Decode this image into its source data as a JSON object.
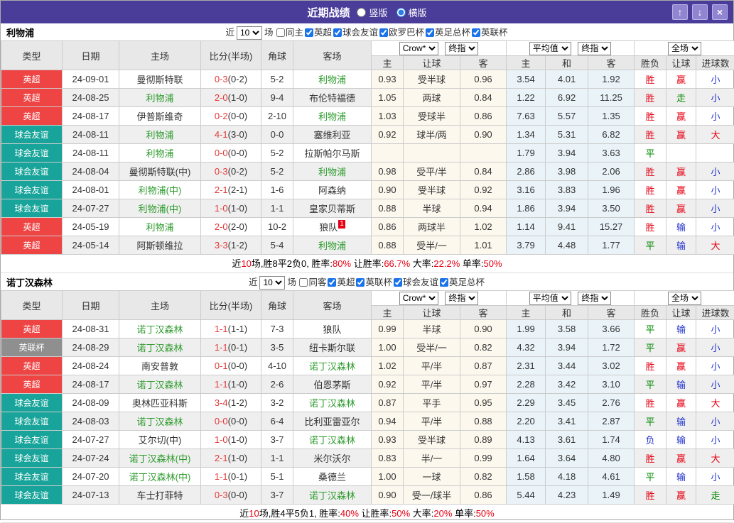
{
  "titlebar": {
    "title": "近期战绩",
    "radios": [
      {
        "label": "竖版",
        "checked": false
      },
      {
        "label": "横版",
        "checked": true
      }
    ],
    "buttons": {
      "up": "↑",
      "down": "↓",
      "close": "×"
    }
  },
  "table_header": {
    "main_cols": [
      "类型",
      "日期",
      "主场",
      "比分(半场)",
      "角球",
      "客场"
    ],
    "sub_cols": [
      "主",
      "让球",
      "客",
      "主",
      "和",
      "客",
      "胜负",
      "让球",
      "进球数"
    ],
    "selects": {
      "asia_company": "Crow*",
      "asia_index": "终指",
      "europe_avg": "平均值",
      "europe_index": "终指",
      "scope": "全场"
    }
  },
  "colors": {
    "titlebar_purple": "#4a3d99",
    "badge_red": "#ee4444",
    "badge_teal": "#18a49a",
    "badge_gray": "#8f8f8f",
    "win_red": "#e60012",
    "draw_green": "#008800",
    "lose_blue": "#2233cc",
    "team_green": "#2e9b2e",
    "asia_col_bg": "#fdf8ee",
    "europe_col_bg": "#e9f3f8"
  },
  "sections": [
    {
      "team": "利物浦",
      "filter": {
        "near": "近",
        "count": "10",
        "unit": "场",
        "same": {
          "label": "同主",
          "checked": false
        },
        "leagues": [
          {
            "label": "英超",
            "checked": true
          },
          {
            "label": "球会友谊",
            "checked": true
          },
          {
            "label": "欧罗巴杯",
            "checked": true
          },
          {
            "label": "英足总杯",
            "checked": true
          },
          {
            "label": "英联杯",
            "checked": true
          }
        ]
      },
      "rows": [
        {
          "league": "英超",
          "badge": "red",
          "date": "24-09-01",
          "home": {
            "name": "曼彻斯特联",
            "hl": false,
            "note": ""
          },
          "score": "0-3",
          "half": "(0-2)",
          "corner": "5-2",
          "away": {
            "name": "利物浦",
            "hl": true,
            "note": ""
          },
          "asia": [
            "0.93",
            "受半球",
            "0.96"
          ],
          "europe": [
            "3.54",
            "4.01",
            "1.92"
          ],
          "outcome": [
            [
              "胜",
              "r"
            ],
            [
              "赢",
              "r"
            ],
            [
              "小",
              "b"
            ]
          ]
        },
        {
          "league": "英超",
          "badge": "red",
          "date": "24-08-25",
          "home": {
            "name": "利物浦",
            "hl": true,
            "note": ""
          },
          "score": "2-0",
          "half": "(1-0)",
          "corner": "9-4",
          "away": {
            "name": "布伦特福德",
            "hl": false,
            "note": ""
          },
          "asia": [
            "1.05",
            "两球",
            "0.84"
          ],
          "europe": [
            "1.22",
            "6.92",
            "11.25"
          ],
          "outcome": [
            [
              "胜",
              "r"
            ],
            [
              "走",
              "g"
            ],
            [
              "小",
              "b"
            ]
          ]
        },
        {
          "league": "英超",
          "badge": "red",
          "date": "24-08-17",
          "home": {
            "name": "伊普斯维奇",
            "hl": false,
            "note": ""
          },
          "score": "0-2",
          "half": "(0-0)",
          "corner": "2-10",
          "away": {
            "name": "利物浦",
            "hl": true,
            "note": ""
          },
          "asia": [
            "1.03",
            "受球半",
            "0.86"
          ],
          "europe": [
            "7.63",
            "5.57",
            "1.35"
          ],
          "outcome": [
            [
              "胜",
              "r"
            ],
            [
              "赢",
              "r"
            ],
            [
              "小",
              "b"
            ]
          ]
        },
        {
          "league": "球会友谊",
          "badge": "teal",
          "date": "24-08-11",
          "home": {
            "name": "利物浦",
            "hl": true,
            "note": ""
          },
          "score": "4-1",
          "half": "(3-0)",
          "corner": "0-0",
          "away": {
            "name": "塞维利亚",
            "hl": false,
            "note": ""
          },
          "asia": [
            "0.92",
            "球半/两",
            "0.90"
          ],
          "europe": [
            "1.34",
            "5.31",
            "6.82"
          ],
          "outcome": [
            [
              "胜",
              "r"
            ],
            [
              "赢",
              "r"
            ],
            [
              "大",
              "r"
            ]
          ]
        },
        {
          "league": "球会友谊",
          "badge": "teal",
          "date": "24-08-11",
          "home": {
            "name": "利物浦",
            "hl": true,
            "note": ""
          },
          "score": "0-0",
          "half": "(0-0)",
          "corner": "5-2",
          "away": {
            "name": "拉斯帕尔马斯",
            "hl": false,
            "note": ""
          },
          "asia": [
            "",
            "",
            ""
          ],
          "europe": [
            "1.79",
            "3.94",
            "3.63"
          ],
          "outcome": [
            [
              "平",
              "g"
            ],
            [
              "",
              ""
            ],
            [
              "",
              ""
            ]
          ]
        },
        {
          "league": "球会友谊",
          "badge": "teal",
          "date": "24-08-04",
          "home": {
            "name": "曼彻斯特联(中)",
            "hl": false,
            "note": ""
          },
          "score": "0-3",
          "half": "(0-2)",
          "corner": "5-2",
          "away": {
            "name": "利物浦",
            "hl": true,
            "note": ""
          },
          "asia": [
            "0.98",
            "受平/半",
            "0.84"
          ],
          "europe": [
            "2.86",
            "3.98",
            "2.06"
          ],
          "outcome": [
            [
              "胜",
              "r"
            ],
            [
              "赢",
              "r"
            ],
            [
              "小",
              "b"
            ]
          ]
        },
        {
          "league": "球会友谊",
          "badge": "teal",
          "date": "24-08-01",
          "home": {
            "name": "利物浦(中)",
            "hl": true,
            "note": ""
          },
          "score": "2-1",
          "half": "(2-1)",
          "corner": "1-6",
          "away": {
            "name": "阿森纳",
            "hl": false,
            "note": ""
          },
          "asia": [
            "0.90",
            "受半球",
            "0.92"
          ],
          "europe": [
            "3.16",
            "3.83",
            "1.96"
          ],
          "outcome": [
            [
              "胜",
              "r"
            ],
            [
              "赢",
              "r"
            ],
            [
              "小",
              "b"
            ]
          ]
        },
        {
          "league": "球会友谊",
          "badge": "teal",
          "date": "24-07-27",
          "home": {
            "name": "利物浦(中)",
            "hl": true,
            "note": ""
          },
          "score": "1-0",
          "half": "(1-0)",
          "corner": "1-1",
          "away": {
            "name": "皇家贝蒂斯",
            "hl": false,
            "note": ""
          },
          "asia": [
            "0.88",
            "半球",
            "0.94"
          ],
          "europe": [
            "1.86",
            "3.94",
            "3.50"
          ],
          "outcome": [
            [
              "胜",
              "r"
            ],
            [
              "赢",
              "r"
            ],
            [
              "小",
              "b"
            ]
          ]
        },
        {
          "league": "英超",
          "badge": "red",
          "date": "24-05-19",
          "home": {
            "name": "利物浦",
            "hl": true,
            "note": ""
          },
          "score": "2-0",
          "half": "(2-0)",
          "corner": "10-2",
          "away": {
            "name": "狼队",
            "hl": false,
            "note": "1"
          },
          "asia": [
            "0.86",
            "两球半",
            "1.02"
          ],
          "europe": [
            "1.14",
            "9.41",
            "15.27"
          ],
          "outcome": [
            [
              "胜",
              "r"
            ],
            [
              "输",
              "b"
            ],
            [
              "小",
              "b"
            ]
          ]
        },
        {
          "league": "英超",
          "badge": "red",
          "date": "24-05-14",
          "home": {
            "name": "阿斯顿维拉",
            "hl": false,
            "note": ""
          },
          "score": "3-3",
          "half": "(1-2)",
          "corner": "5-4",
          "away": {
            "name": "利物浦",
            "hl": true,
            "note": ""
          },
          "asia": [
            "0.88",
            "受半/一",
            "1.01"
          ],
          "europe": [
            "3.79",
            "4.48",
            "1.77"
          ],
          "outcome": [
            [
              "平",
              "g"
            ],
            [
              "输",
              "b"
            ],
            [
              "大",
              "r"
            ]
          ]
        }
      ],
      "summary": [
        [
          "近",
          0
        ],
        [
          "10",
          1
        ],
        [
          "场,胜8平2负0, 胜率:",
          0
        ],
        [
          "80%",
          1
        ],
        [
          " 让胜率:",
          0
        ],
        [
          "66.7%",
          1
        ],
        [
          " 大率:",
          0
        ],
        [
          "22.2%",
          1
        ],
        [
          " 单率:",
          0
        ],
        [
          "50%",
          1
        ]
      ]
    },
    {
      "team": "诺丁汉森林",
      "filter": {
        "near": "近",
        "count": "10",
        "unit": "场",
        "same": {
          "label": "同客",
          "checked": false
        },
        "leagues": [
          {
            "label": "英超",
            "checked": true
          },
          {
            "label": "英联杯",
            "checked": true
          },
          {
            "label": "球会友谊",
            "checked": true
          },
          {
            "label": "英足总杯",
            "checked": true
          }
        ]
      },
      "rows": [
        {
          "league": "英超",
          "badge": "red",
          "date": "24-08-31",
          "home": {
            "name": "诺丁汉森林",
            "hl": true,
            "note": ""
          },
          "score": "1-1",
          "half": "(1-1)",
          "corner": "7-3",
          "away": {
            "name": "狼队",
            "hl": false,
            "note": ""
          },
          "asia": [
            "0.99",
            "半球",
            "0.90"
          ],
          "europe": [
            "1.99",
            "3.58",
            "3.66"
          ],
          "outcome": [
            [
              "平",
              "g"
            ],
            [
              "输",
              "b"
            ],
            [
              "小",
              "b"
            ]
          ]
        },
        {
          "league": "英联杯",
          "badge": "gray",
          "date": "24-08-29",
          "home": {
            "name": "诺丁汉森林",
            "hl": true,
            "note": ""
          },
          "score": "1-1",
          "half": "(0-1)",
          "corner": "3-5",
          "away": {
            "name": "纽卡斯尔联",
            "hl": false,
            "note": ""
          },
          "asia": [
            "1.00",
            "受半/一",
            "0.82"
          ],
          "europe": [
            "4.32",
            "3.94",
            "1.72"
          ],
          "outcome": [
            [
              "平",
              "g"
            ],
            [
              "赢",
              "r"
            ],
            [
              "小",
              "b"
            ]
          ]
        },
        {
          "league": "英超",
          "badge": "red",
          "date": "24-08-24",
          "home": {
            "name": "南安普敦",
            "hl": false,
            "note": ""
          },
          "score": "0-1",
          "half": "(0-0)",
          "corner": "4-10",
          "away": {
            "name": "诺丁汉森林",
            "hl": true,
            "note": ""
          },
          "asia": [
            "1.02",
            "平/半",
            "0.87"
          ],
          "europe": [
            "2.31",
            "3.44",
            "3.02"
          ],
          "outcome": [
            [
              "胜",
              "r"
            ],
            [
              "赢",
              "r"
            ],
            [
              "小",
              "b"
            ]
          ]
        },
        {
          "league": "英超",
          "badge": "red",
          "date": "24-08-17",
          "home": {
            "name": "诺丁汉森林",
            "hl": true,
            "note": ""
          },
          "score": "1-1",
          "half": "(1-0)",
          "corner": "2-6",
          "away": {
            "name": "伯恩茅斯",
            "hl": false,
            "note": ""
          },
          "asia": [
            "0.92",
            "平/半",
            "0.97"
          ],
          "europe": [
            "2.28",
            "3.42",
            "3.10"
          ],
          "outcome": [
            [
              "平",
              "g"
            ],
            [
              "输",
              "b"
            ],
            [
              "小",
              "b"
            ]
          ]
        },
        {
          "league": "球会友谊",
          "badge": "teal",
          "date": "24-08-09",
          "home": {
            "name": "奥林匹亚科斯",
            "hl": false,
            "note": ""
          },
          "score": "3-4",
          "half": "(1-2)",
          "corner": "3-2",
          "away": {
            "name": "诺丁汉森林",
            "hl": true,
            "note": ""
          },
          "asia": [
            "0.87",
            "平手",
            "0.95"
          ],
          "europe": [
            "2.29",
            "3.45",
            "2.76"
          ],
          "outcome": [
            [
              "胜",
              "r"
            ],
            [
              "赢",
              "r"
            ],
            [
              "大",
              "r"
            ]
          ]
        },
        {
          "league": "球会友谊",
          "badge": "teal",
          "date": "24-08-03",
          "home": {
            "name": "诺丁汉森林",
            "hl": true,
            "note": ""
          },
          "score": "0-0",
          "half": "(0-0)",
          "corner": "6-4",
          "away": {
            "name": "比利亚雷亚尔",
            "hl": false,
            "note": ""
          },
          "asia": [
            "0.94",
            "平/半",
            "0.88"
          ],
          "europe": [
            "2.20",
            "3.41",
            "2.87"
          ],
          "outcome": [
            [
              "平",
              "g"
            ],
            [
              "输",
              "b"
            ],
            [
              "小",
              "b"
            ]
          ]
        },
        {
          "league": "球会友谊",
          "badge": "teal",
          "date": "24-07-27",
          "home": {
            "name": "艾尔切(中)",
            "hl": false,
            "note": ""
          },
          "score": "1-0",
          "half": "(1-0)",
          "corner": "3-7",
          "away": {
            "name": "诺丁汉森林",
            "hl": true,
            "note": ""
          },
          "asia": [
            "0.93",
            "受半球",
            "0.89"
          ],
          "europe": [
            "4.13",
            "3.61",
            "1.74"
          ],
          "outcome": [
            [
              "负",
              "b"
            ],
            [
              "输",
              "b"
            ],
            [
              "小",
              "b"
            ]
          ]
        },
        {
          "league": "球会友谊",
          "badge": "teal",
          "date": "24-07-24",
          "home": {
            "name": "诺丁汉森林(中)",
            "hl": true,
            "note": ""
          },
          "score": "2-1",
          "half": "(1-0)",
          "corner": "1-1",
          "away": {
            "name": "米尔沃尔",
            "hl": false,
            "note": ""
          },
          "asia": [
            "0.83",
            "半/一",
            "0.99"
          ],
          "europe": [
            "1.64",
            "3.64",
            "4.80"
          ],
          "outcome": [
            [
              "胜",
              "r"
            ],
            [
              "赢",
              "r"
            ],
            [
              "大",
              "r"
            ]
          ]
        },
        {
          "league": "球会友谊",
          "badge": "teal",
          "date": "24-07-20",
          "home": {
            "name": "诺丁汉森林(中)",
            "hl": true,
            "note": ""
          },
          "score": "1-1",
          "half": "(0-1)",
          "corner": "5-1",
          "away": {
            "name": "桑德兰",
            "hl": false,
            "note": ""
          },
          "asia": [
            "1.00",
            "一球",
            "0.82"
          ],
          "europe": [
            "1.58",
            "4.18",
            "4.61"
          ],
          "outcome": [
            [
              "平",
              "g"
            ],
            [
              "输",
              "b"
            ],
            [
              "小",
              "b"
            ]
          ]
        },
        {
          "league": "球会友谊",
          "badge": "teal",
          "date": "24-07-13",
          "home": {
            "name": "车士打菲特",
            "hl": false,
            "note": ""
          },
          "score": "0-3",
          "half": "(0-0)",
          "corner": "3-7",
          "away": {
            "name": "诺丁汉森林",
            "hl": true,
            "note": ""
          },
          "asia": [
            "0.90",
            "受一/球半",
            "0.86"
          ],
          "europe": [
            "5.44",
            "4.23",
            "1.49"
          ],
          "outcome": [
            [
              "胜",
              "r"
            ],
            [
              "赢",
              "r"
            ],
            [
              "走",
              "g"
            ]
          ]
        }
      ],
      "summary": [
        [
          "近",
          0
        ],
        [
          "10",
          1
        ],
        [
          "场,胜4平5负1, 胜率:",
          0
        ],
        [
          "40%",
          1
        ],
        [
          " 让胜率:",
          0
        ],
        [
          "50%",
          1
        ],
        [
          " 大率:",
          0
        ],
        [
          "20%",
          1
        ],
        [
          " 单率:",
          0
        ],
        [
          "50%",
          1
        ]
      ]
    }
  ]
}
